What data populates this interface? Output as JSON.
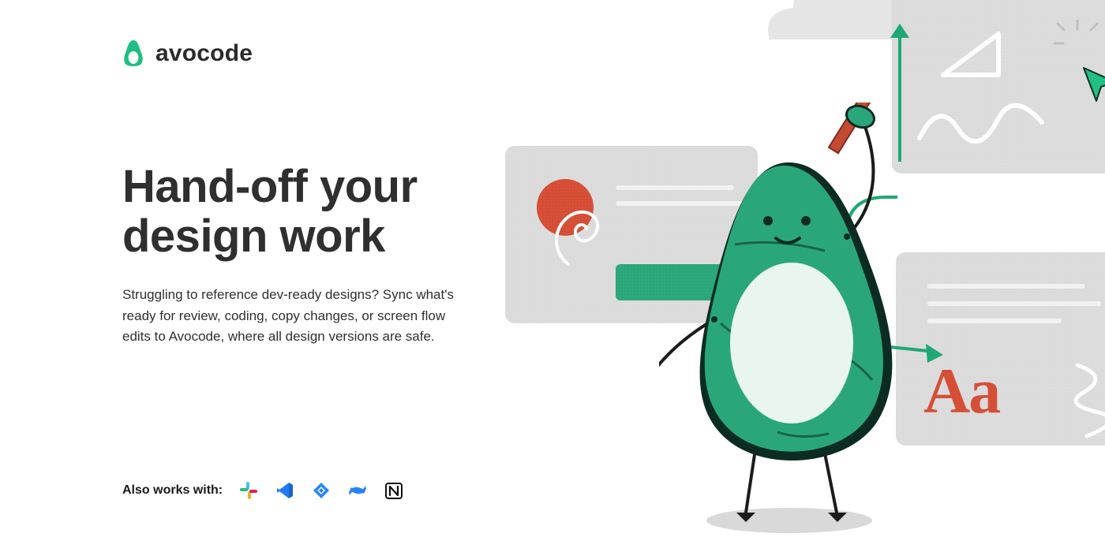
{
  "brand": {
    "name": "avocode"
  },
  "hero": {
    "headline_line1": "Hand-off your",
    "headline_line2": "design work",
    "subtext": "Struggling to reference dev-ready designs? Sync what's ready for review, coding, copy changes, or screen flow edits to Avocode, where all design versions are safe."
  },
  "works_with": {
    "label": "Also works with:",
    "apps": [
      "slack",
      "vscode",
      "jira",
      "confluence",
      "notion"
    ]
  },
  "illustration": {
    "card3_typography_sample": "Aa"
  },
  "colors": {
    "brand_green": "#1fbf83",
    "accent_green": "#2aa77a",
    "accent_red": "#d64d34",
    "card_gray": "#dcdcdc",
    "text_dark": "#2f2f2f"
  }
}
